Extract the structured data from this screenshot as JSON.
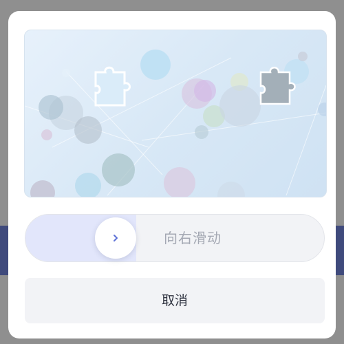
{
  "captcha": {
    "slider_hint": "向右滑动",
    "progress": 0.37,
    "cancel_label": "取消",
    "handle_icon": "chevron-right-icon",
    "piece_icon": "puzzle-piece-icon"
  },
  "colors": {
    "accent": "#5b6fd6",
    "slider_fill": "#e2e6fb",
    "track": "#f2f3f6",
    "hint_text": "#a4a8b3",
    "button_text": "#2f3340"
  }
}
